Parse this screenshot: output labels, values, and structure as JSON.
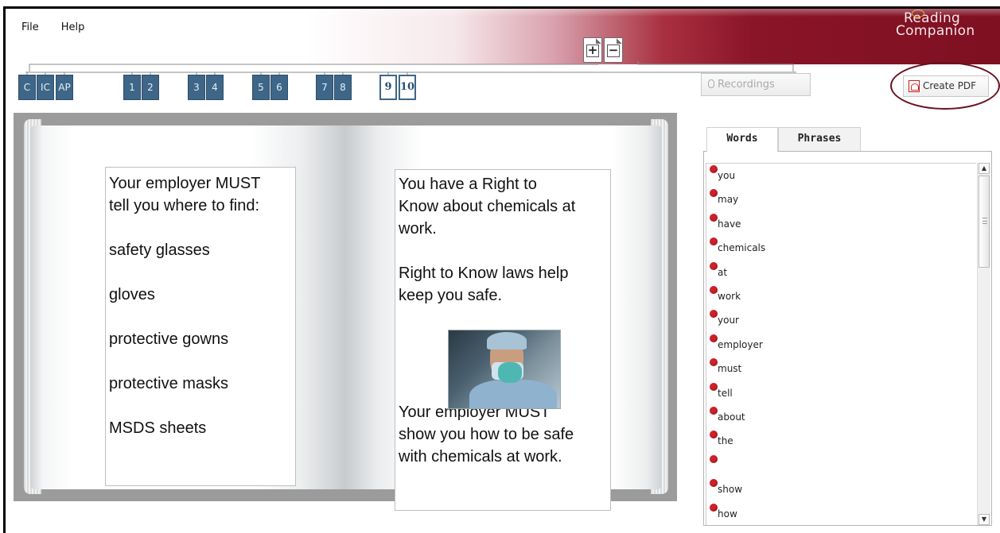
{
  "menu": {
    "file": "File",
    "help": "Help"
  },
  "logo": {
    "line1": "Reading",
    "line2": "Companion"
  },
  "zoom": {
    "in": "+",
    "out": "−"
  },
  "pages": [
    "C",
    "IC",
    "AP",
    "1",
    "2",
    "3",
    "4",
    "5",
    "6",
    "7",
    "8",
    "9",
    "10"
  ],
  "active_pages": [
    "9",
    "10"
  ],
  "toolbar": {
    "recordings": "Recordings",
    "create_pdf": "Create PDF"
  },
  "book": {
    "left_lines": [
      "Your employer MUST",
      "tell you where to find:",
      "",
      "safety glasses",
      "",
      "gloves",
      "",
      "protective gowns",
      "",
      "protective masks",
      "",
      "MSDS sheets"
    ],
    "right_top": [
      "You have a Right to",
      "Know about chemicals at",
      "work.",
      "",
      "Right to Know laws help",
      "keep you safe."
    ],
    "right_bottom": [
      "Your employer MUST",
      "show you how to be safe",
      "with chemicals at work."
    ]
  },
  "panel": {
    "tabs": {
      "words": "Words",
      "phrases": "Phrases"
    },
    "words": [
      "you",
      "may",
      "have",
      "chemicals",
      "at",
      "work",
      "your",
      "employer",
      "must",
      "tell",
      "about",
      "the",
      "",
      "show",
      "how"
    ]
  },
  "colors": {
    "chip_blue": "#3d6688",
    "bullet_red": "#d0202a",
    "banner_maroon": "#7e1022"
  }
}
